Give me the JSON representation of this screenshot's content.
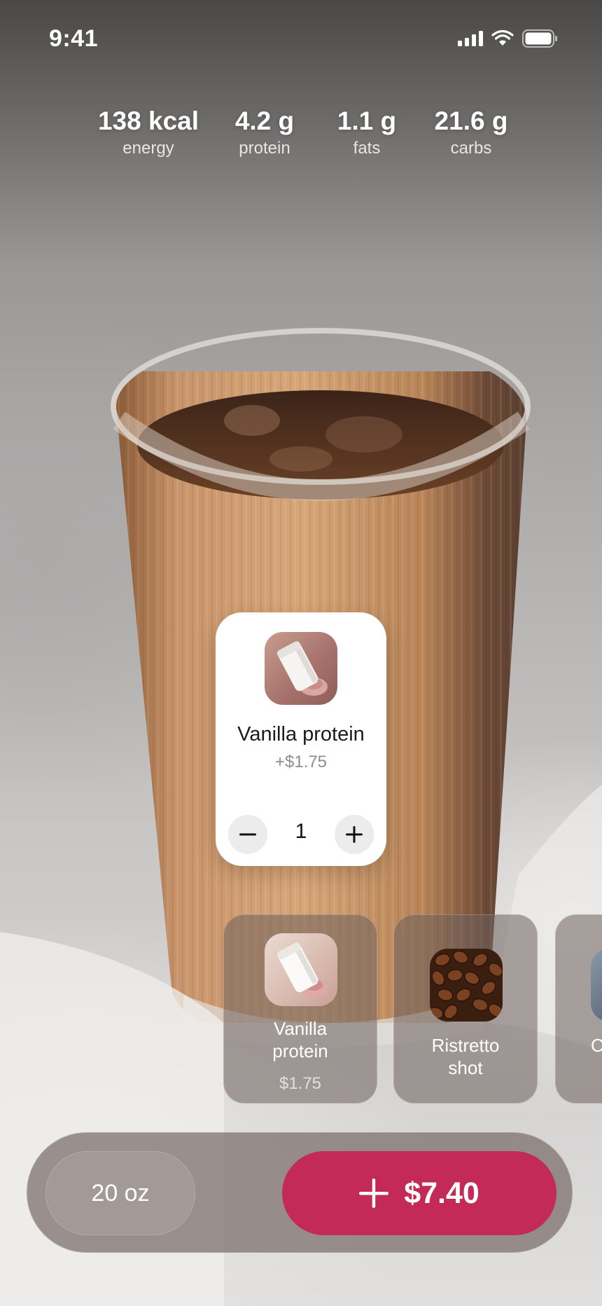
{
  "status_bar": {
    "time": "9:41"
  },
  "nutrition": [
    {
      "value": "138 kcal",
      "label": "energy"
    },
    {
      "value": "4.2 g",
      "label": "protein"
    },
    {
      "value": "1.1 g",
      "label": "fats"
    },
    {
      "value": "21.6 g",
      "label": "carbs"
    }
  ],
  "popup": {
    "title": "Vanilla protein",
    "price": "+$1.75",
    "quantity": "1"
  },
  "addons": [
    {
      "title_line1": "Vanilla",
      "title_line2": "protein",
      "price": "$1.75",
      "icon": "protein-jar-icon"
    },
    {
      "title_line1": "Ristretto",
      "title_line2": "shot",
      "icon": "coffee-beans-icon"
    },
    {
      "title_line1": "C",
      "icon": "addon-icon"
    }
  ],
  "bottom_bar": {
    "size_label": "20 oz",
    "total": "$7.40"
  },
  "colors": {
    "accent": "#c42a58",
    "card_bg": "#ffffff"
  }
}
